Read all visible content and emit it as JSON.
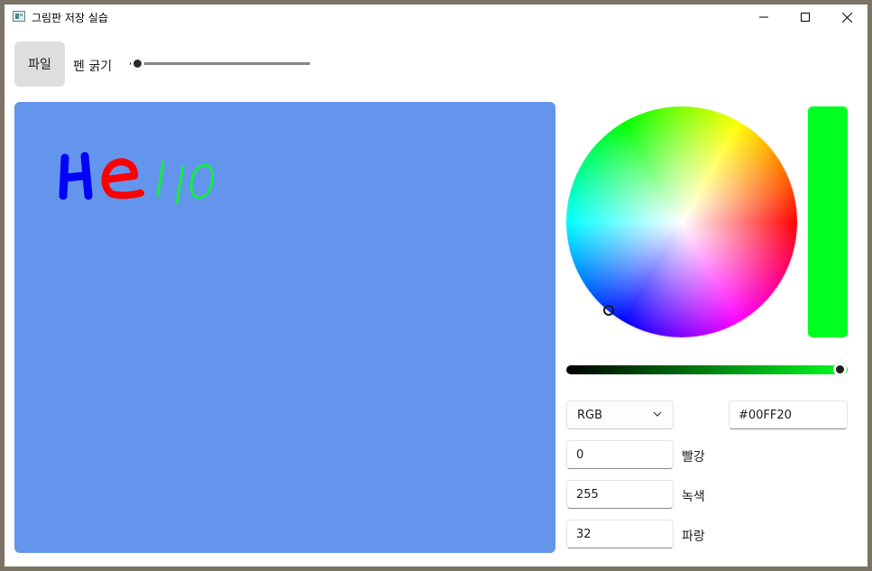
{
  "window": {
    "title": "그림판 저장 실습",
    "icon": "app-window-icon",
    "controls": [
      "minimize-icon",
      "maximize-icon",
      "close-icon"
    ]
  },
  "toolbar": {
    "file_label": "파일",
    "pen_label": "펜 굵기",
    "pen_thickness_fraction": 0.03
  },
  "canvas": {
    "background": "#6495ED",
    "strokes": [
      {
        "letter": "H",
        "color": "#0000FF"
      },
      {
        "letter": "e",
        "color": "#FF0000"
      },
      {
        "letter": "l",
        "color": "#00FF20"
      },
      {
        "letter": "l",
        "color": "#00FF20"
      },
      {
        "letter": "o",
        "color": "#00FF20"
      }
    ]
  },
  "color_picker": {
    "selected_color": "#00FF20",
    "value_fraction": 1.0,
    "mode": "RGB",
    "hex": "#00FF20",
    "channels": [
      {
        "value": "0",
        "label": "빨강"
      },
      {
        "value": "255",
        "label": "녹색"
      },
      {
        "value": "32",
        "label": "파랑"
      }
    ]
  }
}
